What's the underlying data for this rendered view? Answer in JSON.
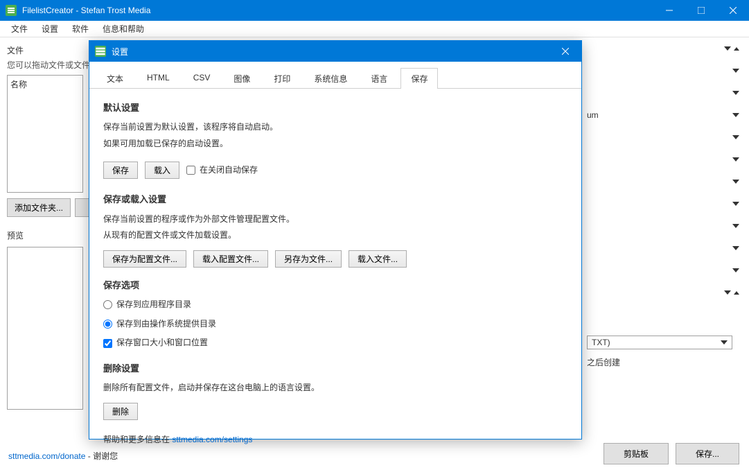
{
  "titlebar": {
    "title": "FilelistCreator - Stefan Trost Media"
  },
  "menubar": {
    "file": "文件",
    "settings": "设置",
    "software": "软件",
    "help": "信息和帮助"
  },
  "main": {
    "files_label": "文件",
    "files_hint": "您可以拖动文件或文件",
    "name_col": "名称",
    "add_folder_btn": "添加文件夹...",
    "preview_label": "预览"
  },
  "right": {
    "um_text": "um",
    "txt_option": "TXT)",
    "after_create": "之后创建",
    "clipboard_btn": "剪贴板",
    "save_btn": "保存..."
  },
  "status": {
    "donate_link": "sttmedia.com/donate",
    "thanks": " - 谢谢您"
  },
  "dialog": {
    "title": "设置",
    "tabs": {
      "text": "文本",
      "html": "HTML",
      "csv": "CSV",
      "image": "图像",
      "print": "打印",
      "sysinfo": "系统信息",
      "language": "语言",
      "save": "保存"
    },
    "sec1": {
      "title": "默认设置",
      "line1": "保存当前设置为默认设置，该程序将自动启动。",
      "line2": "如果可用加载已保存的启动设置。",
      "save_btn": "保存",
      "load_btn": "载入",
      "autosave_cb": "在关闭自动保存"
    },
    "sec2": {
      "title": "保存或载入设置",
      "line1": "保存当前设置的程序或作为外部文件管理配置文件。",
      "line2": "从现有的配置文件或文件加载设置。",
      "btn1": "保存为配置文件...",
      "btn2": "载入配置文件...",
      "btn3": "另存为文件...",
      "btn4": "载入文件..."
    },
    "sec3": {
      "title": "保存选项",
      "radio1": "保存到应用程序目录",
      "radio2": "保存到由操作系统提供目录",
      "cb1": "保存窗口大小和窗口位置"
    },
    "sec4": {
      "title": "删除设置",
      "line1": "删除所有配置文件，启动并保存在这台电脑上的语言设置。",
      "btn": "删除"
    },
    "help": {
      "prefix": "帮助和更多信息在 ",
      "link": "sttmedia.com/settings"
    }
  }
}
